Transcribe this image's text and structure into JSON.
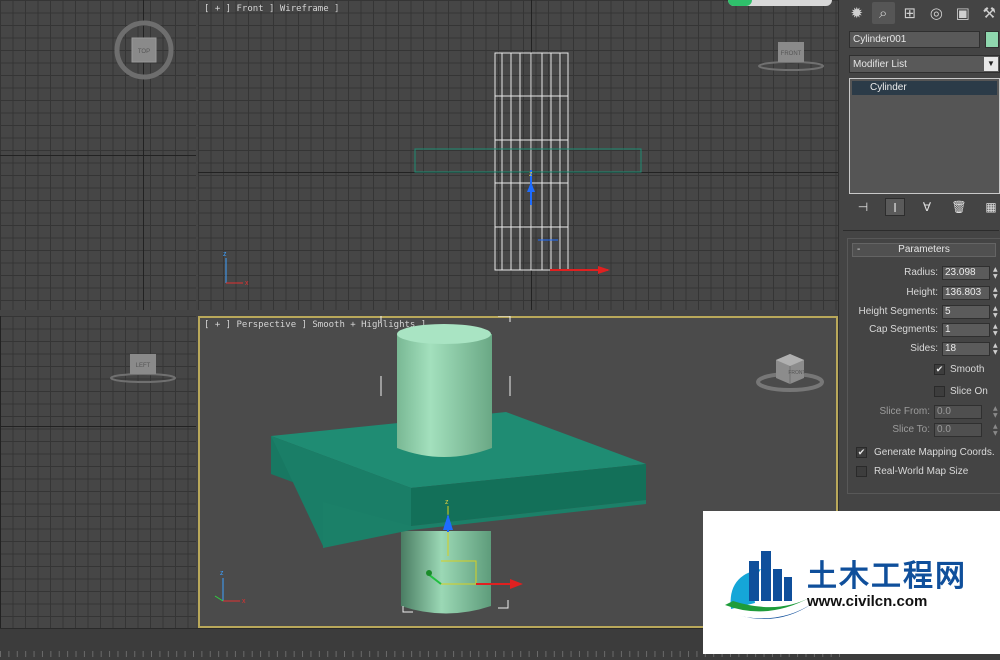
{
  "viewports": {
    "front_label": "[ + ] Front ] Wireframe ]",
    "perspective_label": "[ + ] Perspective ] Smooth + Highlights ]",
    "top_cube": "TOP",
    "front_cube": "FRONT",
    "left_cube": "LEFT",
    "persp_cube": "FRONT"
  },
  "command_panel": {
    "tabs": [
      {
        "icon": "create-icon",
        "glyph": "✹"
      },
      {
        "icon": "modify-icon",
        "glyph": "⌕"
      },
      {
        "icon": "hierarchy-icon",
        "glyph": "⊞"
      },
      {
        "icon": "motion-icon",
        "glyph": "◎"
      },
      {
        "icon": "display-icon",
        "glyph": "▣"
      },
      {
        "icon": "utilities-icon",
        "glyph": "⚒"
      }
    ],
    "object_name": "Cylinder001",
    "object_color": "#8fd7ae",
    "modifier_list": "Modifier List",
    "stack_items": [
      "Cylinder"
    ],
    "stack_tools": [
      {
        "icon": "pin-stack-icon",
        "glyph": "⊣"
      },
      {
        "icon": "show-end-result-icon",
        "glyph": "I"
      },
      {
        "icon": "make-unique-icon",
        "glyph": "∀"
      },
      {
        "icon": "remove-modifier-icon",
        "glyph": "🗑"
      },
      {
        "icon": "configure-modifier-sets-icon",
        "glyph": "▦"
      }
    ],
    "parameters": {
      "title": "Parameters",
      "collapse": "-",
      "fields": [
        {
          "label": "Radius:",
          "value": "23.098"
        },
        {
          "label": "Height:",
          "value": "136.803"
        },
        {
          "label": "Height Segments:",
          "value": "5"
        },
        {
          "label": "Cap Segments:",
          "value": "1"
        },
        {
          "label": "Sides:",
          "value": "18"
        }
      ],
      "smooth": {
        "label": "Smooth",
        "checked": true
      },
      "slice_on": {
        "label": "Slice On",
        "checked": false
      },
      "slice_from": {
        "label": "Slice From:",
        "value": "0.0"
      },
      "slice_to": {
        "label": "Slice To:",
        "value": "0.0"
      },
      "gen_mapping": {
        "label": "Generate Mapping Coords.",
        "checked": true
      },
      "real_world": {
        "label": "Real-World Map Size",
        "checked": false
      }
    }
  },
  "watermark": {
    "name": "土木工程网",
    "url": "www.civilcn.com"
  },
  "colors": {
    "accent_viewport": "#b9a85a",
    "object_teal": "#1f8c73",
    "object_green": "#8fd7ae"
  }
}
